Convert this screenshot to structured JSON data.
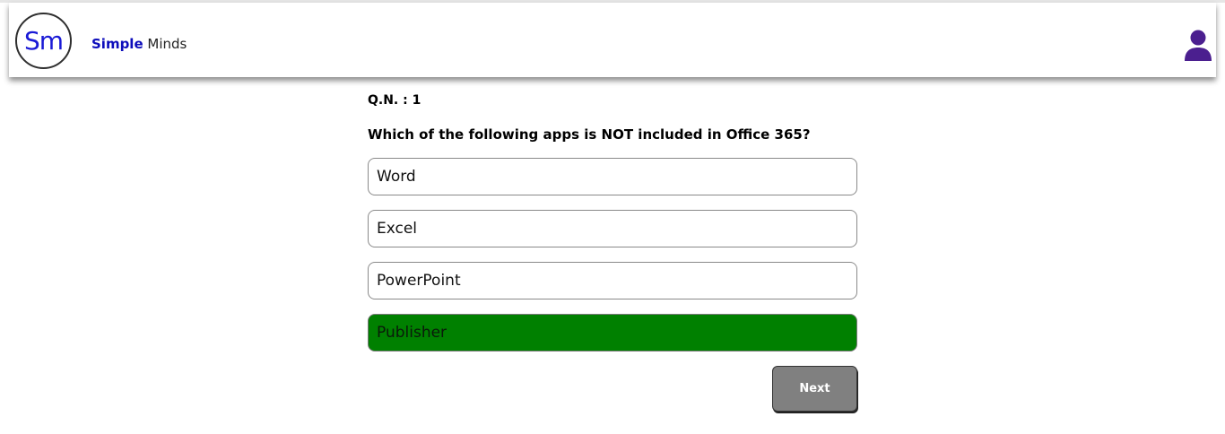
{
  "header": {
    "logo_text": "Sm",
    "brand_strong": "Simple",
    "brand_rest": " Minds",
    "user_icon": "user-icon"
  },
  "colors": {
    "brand_blue": "#0d0dbb",
    "selected_option": "#008000",
    "user_icon": "#4b1f8f",
    "next_button": "#808080"
  },
  "quiz": {
    "question_number": "Q.N. : 1",
    "question": "Which of the following apps is NOT included in Office 365?",
    "options": [
      {
        "label": "Word",
        "selected": false
      },
      {
        "label": "Excel",
        "selected": false
      },
      {
        "label": "PowerPoint",
        "selected": false
      },
      {
        "label": "Publisher",
        "selected": true
      }
    ],
    "next_label": "Next"
  }
}
